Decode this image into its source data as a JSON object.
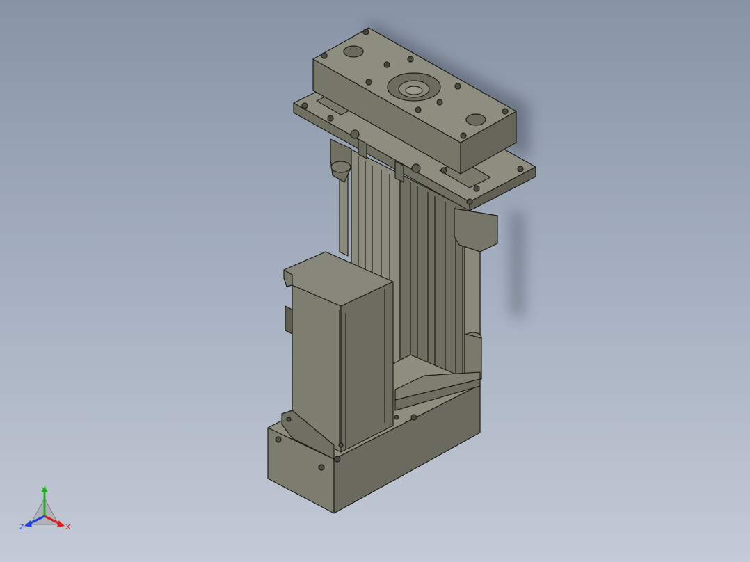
{
  "viewport": {
    "background_top": "#8894a6",
    "background_bottom": "#c4cad6",
    "model_color": "#7a7a6c",
    "edge_color": "#1e1e1a"
  },
  "triad": {
    "x_label": "X",
    "y_label": "Y",
    "z_label": "Z",
    "x_color": "#d42020",
    "y_color": "#20b020",
    "z_color": "#2040d8"
  }
}
